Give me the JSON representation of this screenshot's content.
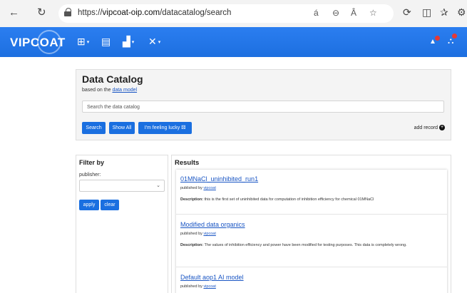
{
  "browser": {
    "url_prefix": "https://",
    "url_host": "vipcoat-oip.com",
    "url_path": "/datacatalog/search",
    "back_glyph": "←",
    "refresh_glyph": "↻",
    "read_aloud_glyph": "á",
    "zoom_glyph": "⊖",
    "font_glyph": "Â",
    "favorite_glyph": "☆",
    "extensions_glyph": "⟳",
    "split_glyph": "◫",
    "favorites_bar_glyph": "✰",
    "profile_glyph": "⚙"
  },
  "app": {
    "logo": "VIPCOAT",
    "grid_glyph": "⊞",
    "book_glyph": "▤",
    "chart_glyph": "▟",
    "tools_glyph": "✕",
    "bell_glyph": "▲",
    "users_glyph": "⛬"
  },
  "catalog": {
    "title": "Data Catalog",
    "subtitle_text": "based on the ",
    "subtitle_link": "data model",
    "search_placeholder": "Search the data catalog",
    "search_button": "Search",
    "show_all_button": "Show All",
    "lucky_button": "I'm feeling lucky",
    "add_record": "add record"
  },
  "filter": {
    "title": "Filter by",
    "publisher_label": "publisher:",
    "publisher_value": "",
    "apply_button": "apply",
    "clear_button": "clear"
  },
  "results": {
    "title": "Results",
    "items": [
      {
        "title": "01MNaCl_uninhibited_run1",
        "published_by": "published by ",
        "publisher": "vipcoat",
        "desc_label": "Description:",
        "desc": " this is the first set of uninhibited data for computation of inhibition efficiency for chemical 01MNaCl"
      },
      {
        "title": "Modified data organics",
        "published_by": "published by ",
        "publisher": "vipcoat",
        "desc_label": "Description:",
        "desc": " The values of inhibition efficiency and power have been modified for testing purposes. This data is completely wrong."
      },
      {
        "title": "Default aop1 AI model",
        "published_by": "published by ",
        "publisher": "vipcoat",
        "desc_label": "",
        "desc": ""
      }
    ]
  },
  "colors": {
    "primary": "#1a6fe0",
    "link": "#1a56c4",
    "navbar": "#1d6fe0"
  }
}
